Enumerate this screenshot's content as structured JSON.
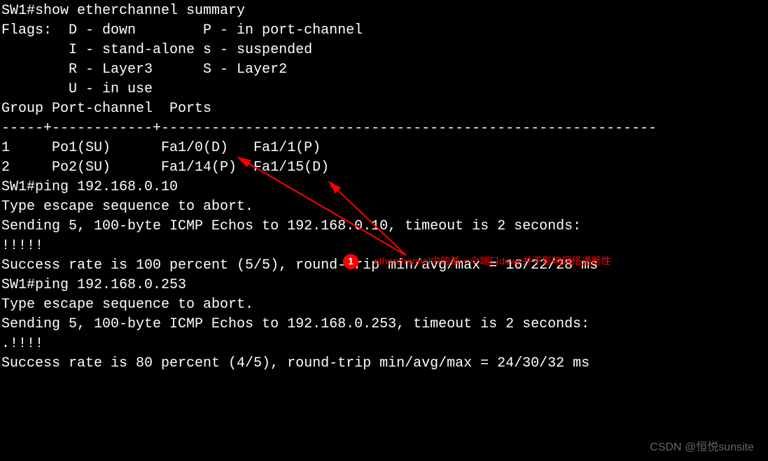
{
  "terminal": {
    "lines": [
      "SW1#show etherchannel summary",
      "Flags:  D - down        P - in port-channel",
      "        I - stand-alone s - suspended",
      "        R - Layer3      S - Layer2",
      "        U - in use",
      "Group Port-channel  Ports",
      "-----+------------+-----------------------------------------------------------",
      "1     Po1(SU)      Fa1/0(D)   Fa1/1(P)   ",
      "2     Po2(SU)      Fa1/14(P)  Fa1/15(D)  ",
      "",
      "SW1#ping 192.168.0.10",
      "",
      "Type escape sequence to abort.",
      "Sending 5, 100-byte ICMP Echos to 192.168.0.10, timeout is 2 seconds:",
      "!!!!!",
      "Success rate is 100 percent (5/5), round-trip min/avg/max = 16/22/28 ms",
      "SW1#ping 192.168.0.253",
      "",
      "Type escape sequence to abort.",
      "Sending 5, 100-byte ICMP Echos to 192.168.0.253, timeout is 2 seconds:",
      ".!!!!",
      "Success rate is 80 percent (4/5), round-trip min/avg/max = 24/30/32 ms"
    ]
  },
  "annotation": {
    "badge_number": "1",
    "text": "etherchannel中的某一个端口down并不影响网络通断性"
  },
  "watermark": "CSDN @恒悦sunsite"
}
